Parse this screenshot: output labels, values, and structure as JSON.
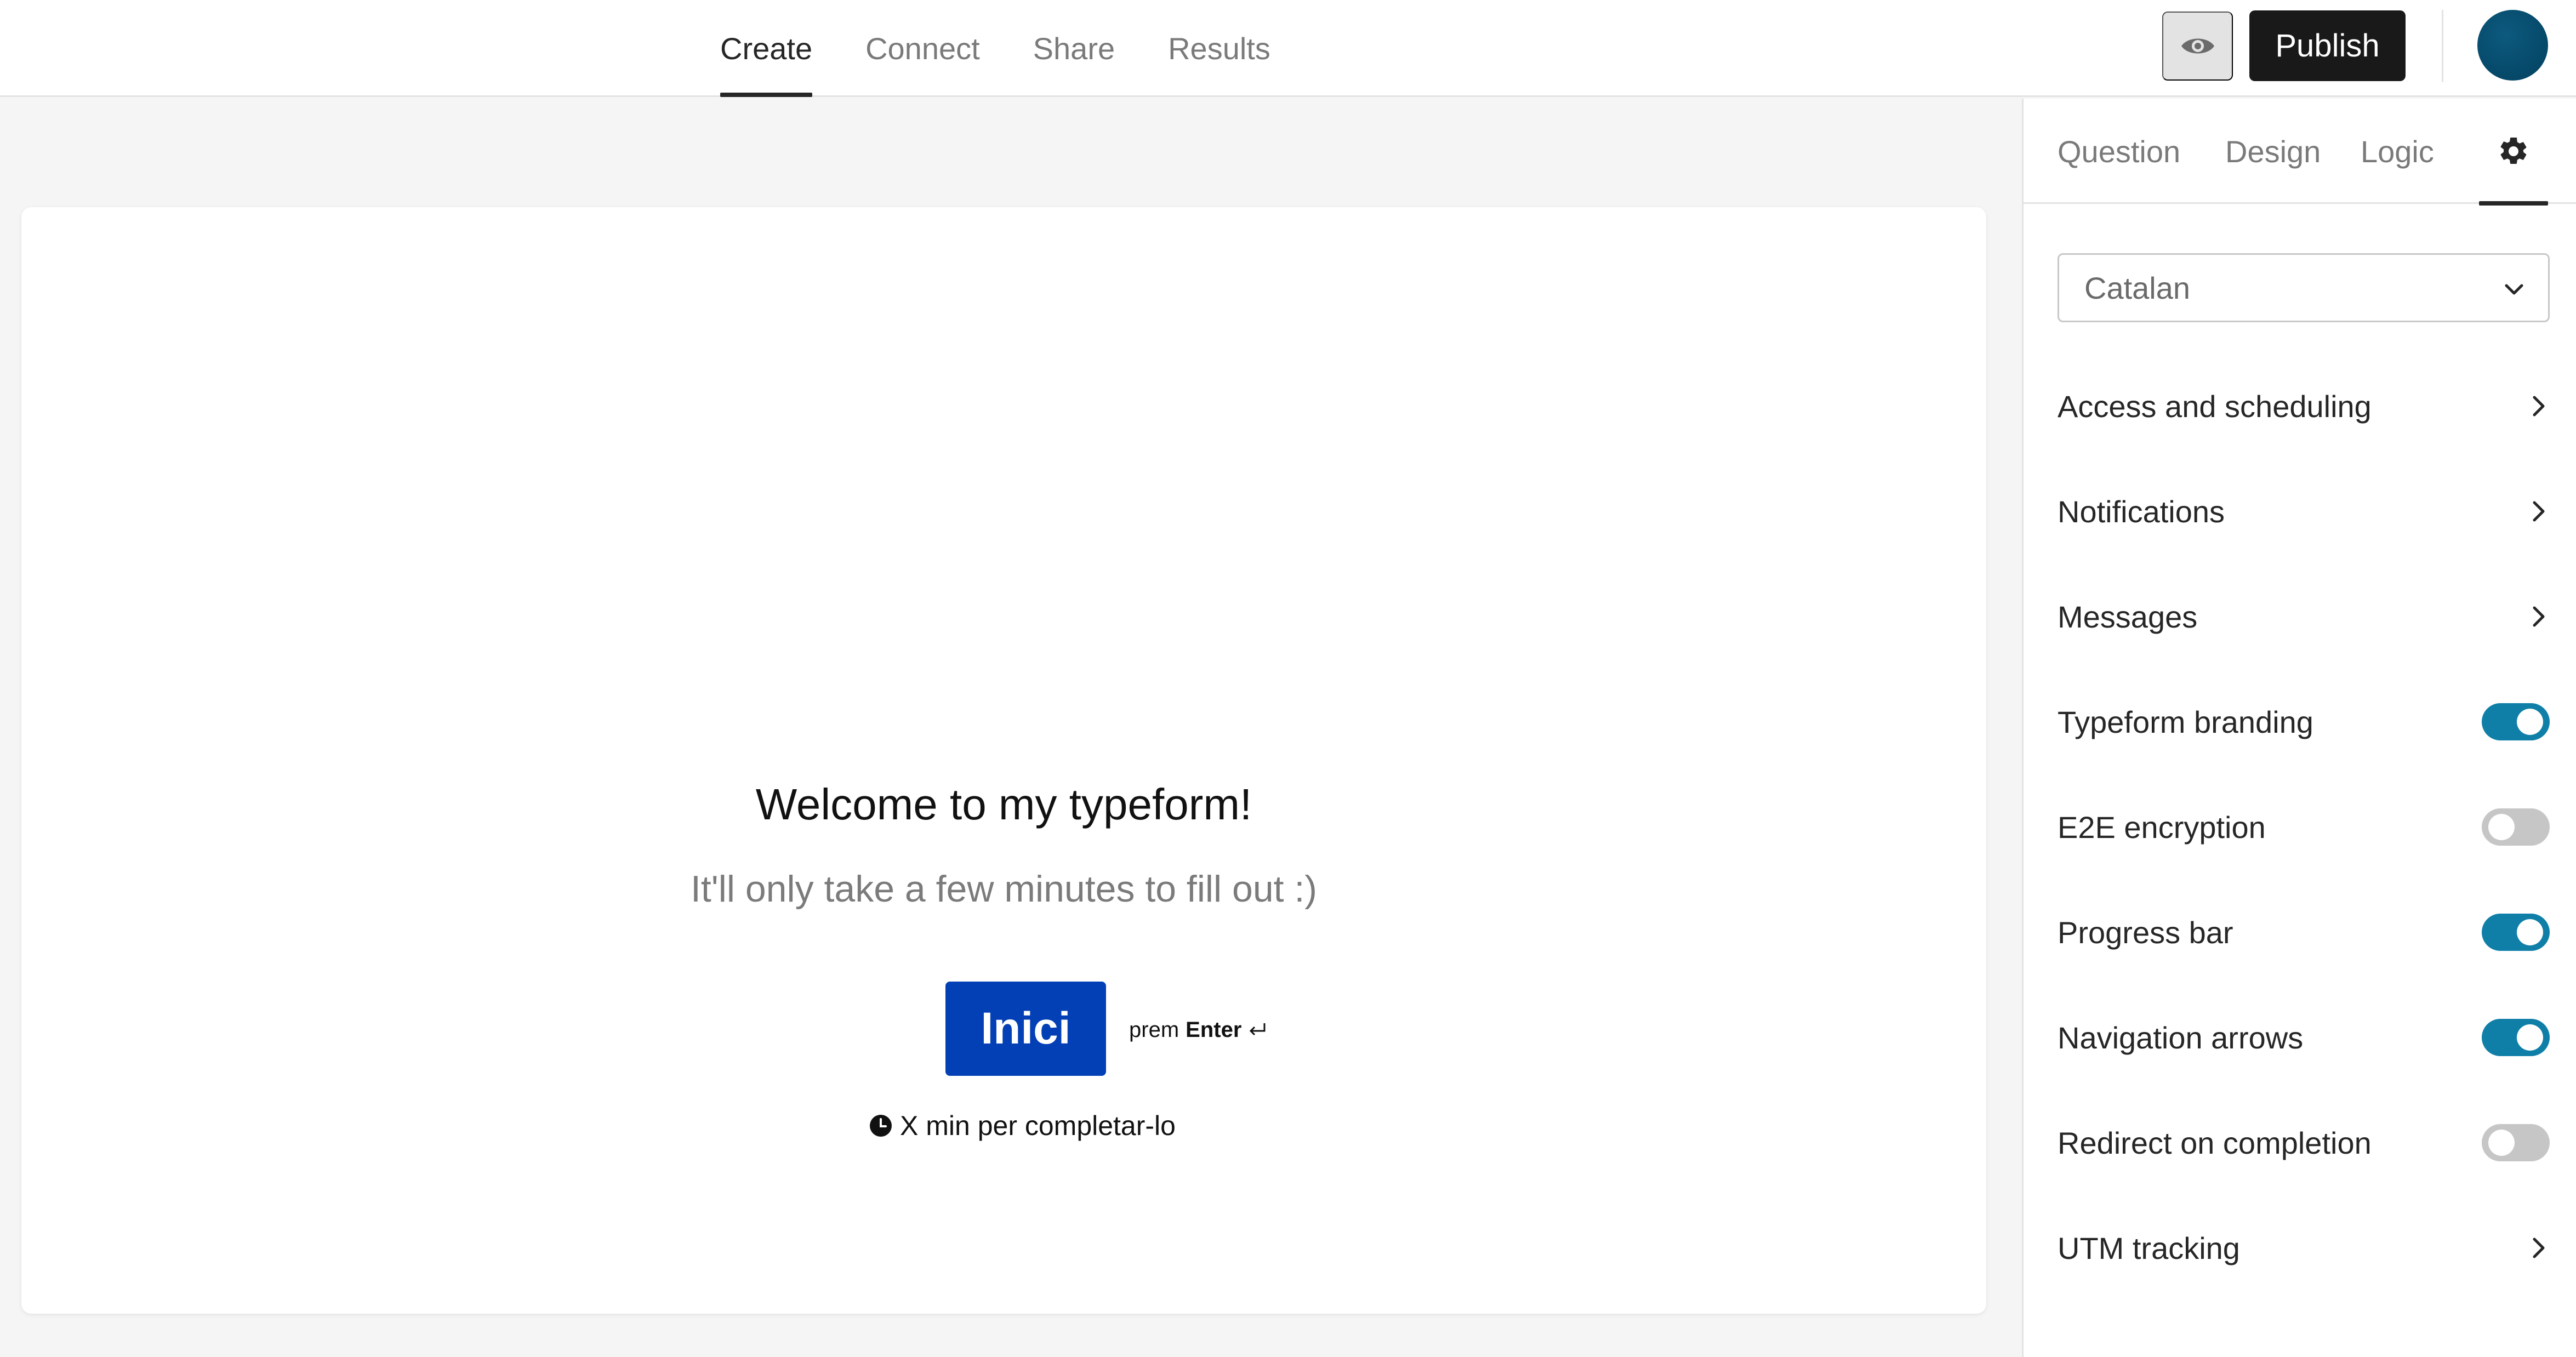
{
  "topnav": {
    "tabs": [
      {
        "label": "Create",
        "active": true
      },
      {
        "label": "Connect",
        "active": false
      },
      {
        "label": "Share",
        "active": false
      },
      {
        "label": "Results",
        "active": false
      }
    ],
    "preview_icon": "eye-icon",
    "publish_label": "Publish",
    "avatar_color": "#03405f"
  },
  "form": {
    "title": "Welcome to my typeform!",
    "subtitle": "It'll only take a few minutes to fill out :)",
    "start_button_label": "Inici",
    "start_button_color": "#0340b5",
    "enter_prefix": "prem",
    "enter_key": "Enter",
    "time_text": "X min per completar-lo"
  },
  "panel": {
    "tabs": [
      "Question",
      "Design",
      "Logic"
    ],
    "settings_icon": "gear-icon",
    "language": "Catalan",
    "settings": [
      {
        "label": "Access and scheduling",
        "control": "chevron"
      },
      {
        "label": "Notifications",
        "control": "chevron"
      },
      {
        "label": "Messages",
        "control": "chevron"
      },
      {
        "label": "Typeform branding",
        "control": "toggle",
        "on": true
      },
      {
        "label": "E2E encryption",
        "control": "toggle",
        "on": false
      },
      {
        "label": "Progress bar",
        "control": "toggle",
        "on": true
      },
      {
        "label": "Navigation arrows",
        "control": "toggle",
        "on": true
      },
      {
        "label": "Redirect on completion",
        "control": "toggle",
        "on": false
      },
      {
        "label": "UTM tracking",
        "control": "chevron"
      }
    ],
    "toggle_on_color": "#0f7fa8"
  }
}
